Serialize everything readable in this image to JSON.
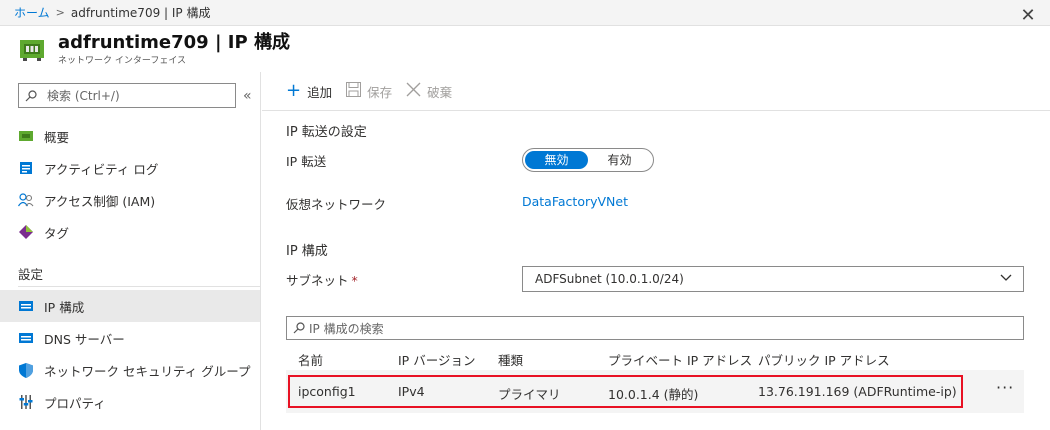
{
  "breadcrumb": {
    "home": "ホーム",
    "current": "adfruntime709 | IP 構成"
  },
  "header": {
    "title": "adfruntime709 | IP 構成",
    "subtitle": "ネットワーク インターフェイス",
    "close": "✕"
  },
  "sidebar": {
    "search_placeholder": "検索 (Ctrl+/)",
    "collapse": "«",
    "items": [
      {
        "label": "概要",
        "icon": "overview-icon"
      },
      {
        "label": "アクティビティ ログ",
        "icon": "activity-log-icon"
      },
      {
        "label": "アクセス制御 (IAM)",
        "icon": "iam-icon"
      },
      {
        "label": "タグ",
        "icon": "tag-icon"
      }
    ],
    "settings_header": "設定",
    "settings_items": [
      {
        "label": "IP 構成",
        "icon": "ip-config-icon",
        "active": true
      },
      {
        "label": "DNS サーバー",
        "icon": "dns-icon"
      },
      {
        "label": "ネットワーク セキュリティ グループ",
        "icon": "nsg-shield-icon"
      },
      {
        "label": "プロパティ",
        "icon": "properties-icon"
      }
    ]
  },
  "toolbar": {
    "add": "追加",
    "save": "保存",
    "discard": "破棄"
  },
  "main": {
    "forwarding_section": "IP 転送の設定",
    "forwarding_label": "IP 転送",
    "toggle": {
      "off": "無効",
      "on": "有効",
      "selected": "無効"
    },
    "vnet_label": "仮想ネットワーク",
    "vnet_value": "DataFactoryVNet",
    "ipconfig_section": "IP 構成",
    "subnet_label": "サブネット",
    "subnet_required": "*",
    "subnet_value": "ADFSubnet (10.0.1.0/24)",
    "table_search_placeholder": "IP 構成の検索",
    "columns": [
      "名前",
      "IP バージョン",
      "種類",
      "プライベート IP アドレス",
      "パブリック IP アドレス"
    ],
    "rows": [
      {
        "name": "ipconfig1",
        "version": "IPv4",
        "type": "プライマリ",
        "private_ip": "10.0.1.4 (静的)",
        "public_ip": "13.76.191.169 (ADFRuntime-ip)",
        "more": "···"
      }
    ]
  },
  "colors": {
    "accent": "#0078d4",
    "highlight": "#e81123"
  }
}
